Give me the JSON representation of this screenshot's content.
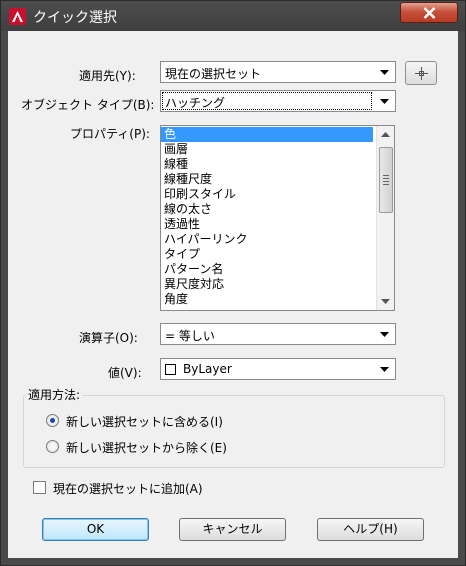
{
  "window": {
    "title": "クイック選択",
    "close_icon": "close-icon"
  },
  "apply_to": {
    "label": "適用先(Y):",
    "value": "現在の選択セット",
    "pick_icon": "pick-objects-icon"
  },
  "object_type": {
    "label": "オブジェクト タイプ(B):",
    "value": "ハッチング"
  },
  "properties": {
    "label": "プロパティ(P):",
    "items": [
      "色",
      "画層",
      "線種",
      "線種尺度",
      "印刷スタイル",
      "線の太さ",
      "透過性",
      "ハイパーリンク",
      "タイプ",
      "パターン名",
      "異尺度対応",
      "角度"
    ],
    "selected_index": 0
  },
  "operator": {
    "label": "演算子(O):",
    "value": "= 等しい"
  },
  "value": {
    "label": "値(V):",
    "value": "ByLayer",
    "swatch_color": "#ffffff"
  },
  "how_to_apply": {
    "legend": "適用方法:",
    "include_label": "新しい選択セットに含める(I)",
    "exclude_label": "新しい選択セットから除く(E)",
    "selected": "include"
  },
  "append": {
    "label": "現在の選択セットに追加(A)",
    "checked": false
  },
  "buttons": {
    "ok": "OK",
    "cancel": "キャンセル",
    "help": "ヘルプ(H)"
  },
  "colors": {
    "selection": "#3399ff",
    "close_button": "#c7513b",
    "app_icon": "#c8102e"
  }
}
